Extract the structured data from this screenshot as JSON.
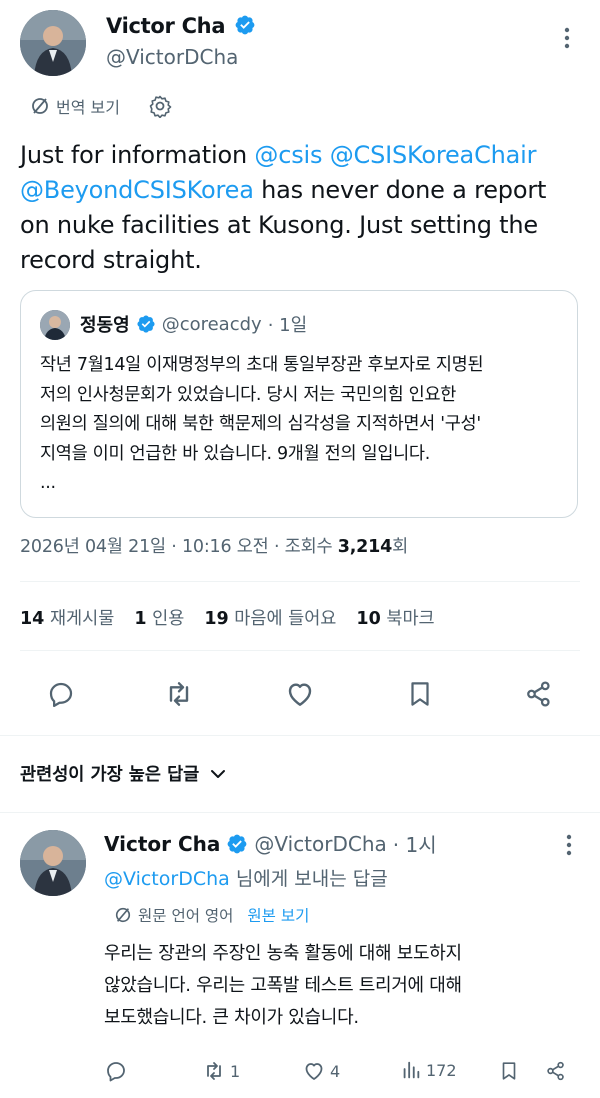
{
  "tweet": {
    "author_name": "Victor Cha",
    "author_handle": "@VictorDCha",
    "translate_label": "번역 보기",
    "text_prefix": "Just for information ",
    "mention1": "@csis",
    "mention2": "@CSISKoreaChair",
    "mention3": "@BeyondCSISKorea",
    "text_line3_rest": " has never done a report",
    "text_line4": "on nuke facilities at Kusong. Just setting the",
    "text_line5": "record straight.",
    "timestamp": "2026년 04월 21일 · 10:16 오전 · 조회수 ",
    "view_count": "3,214",
    "view_suffix": "회"
  },
  "quote": {
    "author_name": "정동영",
    "author_handle": "@coreacdy",
    "time": "· 1일",
    "line1": "작년 7월14일 이재명정부의 초대 통일부장관 후보자로 지명된",
    "line2": "저의 인사청문회가 있었습니다. 당시 저는 국민의힘 인요한",
    "line3": "의원의 질의에 대해 북한 핵문제의 심각성을 지적하면서 '구성'",
    "line4": "지역을 이미 언급한 바 있습니다. 9개월 전의 일입니다.",
    "ellipsis": "..."
  },
  "stats": {
    "retweets_count": "14",
    "retweets_label": "재게시물",
    "quotes_count": "1",
    "quotes_label": "인용",
    "likes_count": "19",
    "likes_label": "마음에 들어요",
    "bookmarks_count": "10",
    "bookmarks_label": "북마크"
  },
  "sort": {
    "label": "관련성이 가장 높은 답글"
  },
  "reply": {
    "author_name": "Victor Cha",
    "author_handle": "@VictorDCha",
    "time": "· 1시",
    "replying_handle": "@VictorDCha",
    "replying_suffix": " 님에게 보내는 답글",
    "original_lang_label": "원문 언어 영어",
    "view_original_label": "원본 보기",
    "line1": "우리는 장관의 주장인 농축 활동에 대해 보도하지",
    "line2": "않았습니다. 우리는 고폭발 테스트 트리거에 대해",
    "line3": "보도했습니다. 큰 차이가 있습니다.",
    "retweet_count": "1",
    "like_count": "4",
    "view_count": "172"
  },
  "colors": {
    "accent": "#1d9bf0",
    "text": "#0f1419",
    "muted": "#536471"
  },
  "icons": [
    "more-icon",
    "verified-badge-icon",
    "translate-icon",
    "gear-icon",
    "reply-icon",
    "retweet-icon",
    "heart-icon",
    "bookmark-icon",
    "share-icon",
    "chevron-down-icon",
    "views-icon"
  ]
}
